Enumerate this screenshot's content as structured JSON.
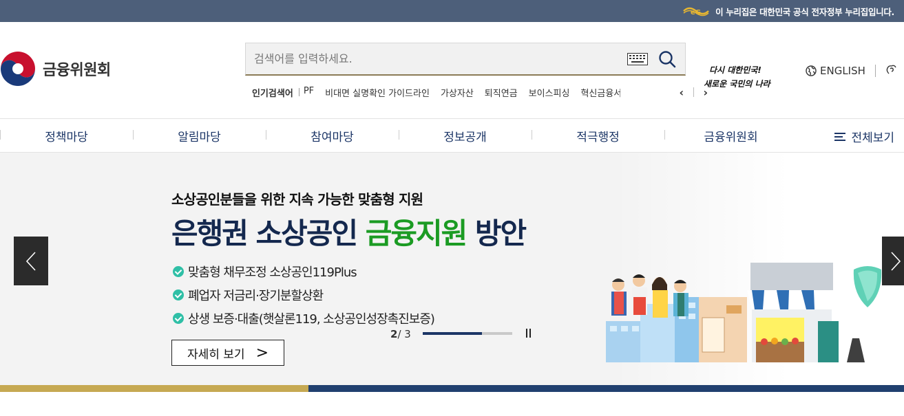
{
  "gov_banner": {
    "text": "이 누리집은 대한민국 공식 전자정부 누리집입니다."
  },
  "logo": {
    "text": "금융위원회"
  },
  "search": {
    "placeholder": "검색어를 입력하세요."
  },
  "popular": {
    "title": "인기검색어",
    "keywords": [
      "PF",
      "비대면 실명확인 가이드라인",
      "가상자산",
      "퇴직연금",
      "보이스피싱",
      "혁신금융서비스"
    ],
    "prev": "‹",
    "next": "›"
  },
  "slogan": {
    "line1": "다시 대한민국!",
    "line2": "새로운 국민의 나라"
  },
  "lang": {
    "english": "ENGLISH"
  },
  "gnb": {
    "items": [
      "정책마당",
      "알림마당",
      "참여마당",
      "정보공개",
      "적극행정",
      "금융위원회"
    ],
    "all_menu": "전체보기"
  },
  "hero": {
    "subtitle": "소상공인분들을 위한 지속 가능한 맞춤형 지원",
    "title_navy_1": "은행권 소상공인 ",
    "title_green": "금융지원",
    "title_navy_2": " 방안",
    "bullets": [
      "맞춤형 채무조정 소상공인119Plus",
      "폐업자 저금리·장기분할상환",
      "상생 보증·대출(햇살론119, 소상공인성장촉진보증)"
    ],
    "more_label": "자세히 보기",
    "more_arrow": ">",
    "pager_current": "2",
    "pager_total": " / 3",
    "progress": 0.66
  },
  "colors": {
    "navy": "#14284e",
    "green": "#1b9b23",
    "gold": "#c6a952",
    "bar_navy": "#21406f",
    "gov_bar": "#4d5f7a"
  }
}
